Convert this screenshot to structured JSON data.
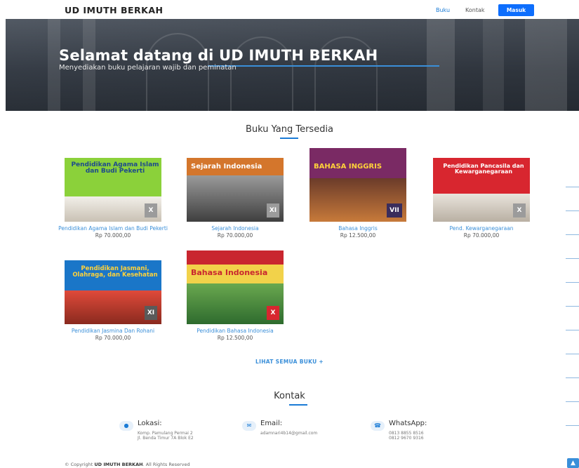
{
  "header": {
    "brand": "UD IMUTH BERKAH",
    "nav": {
      "buku": "Buku",
      "kontak": "Kontak"
    },
    "login_button": "Masuk"
  },
  "hero": {
    "title": "Selamat datang di UD IMUTH BERKAH",
    "subtitle": "Menyediakan buku pelajaran wajib dan peminatan"
  },
  "books_section": {
    "title": "Buku Yang Tersedia",
    "books": [
      {
        "name": "Pendidikan Agama Islam dan Budi Pekerti",
        "price": "Rp 70.000,00",
        "cover_title": "Pendidikan Agama Islam dan Budi Pekerti",
        "cover_color": "#8bd13a",
        "badge": "X"
      },
      {
        "name": "Sejarah Indonesia",
        "price": "Rp 70.000,00",
        "cover_title": "Sejarah Indonesia",
        "cover_color": "#d4762c",
        "badge": "XI"
      },
      {
        "name": "Bahasa Inggris",
        "price": "Rp 12.500,00",
        "cover_title": "BAHASA INGGRIS",
        "cover_color": "#7a2a64",
        "badge": "VII"
      },
      {
        "name": "Pend. Kewarganegaraan",
        "price": "Rp 70.000,00",
        "cover_title": "Pendidikan Pancasila dan Kewarganegaraan",
        "cover_color": "#d8262f",
        "badge": "X"
      },
      {
        "name": "Pendidikan Jasmina Dan Rohani",
        "price": "Rp 70.000,00",
        "cover_title": "Pendidikan Jasmani, Olahraga, dan Kesehatan",
        "cover_color": "#1a76c8",
        "badge": "XI"
      },
      {
        "name": "Pendidikan Bahasa Indonesia",
        "price": "Rp 12.500,00",
        "cover_title": "Bahasa Indonesia",
        "cover_color": "#f2d24a",
        "badge": "X"
      }
    ],
    "see_all": "LIHAT SEMUA BUKU +"
  },
  "contact_section": {
    "title": "Kontak",
    "location": {
      "label": "Lokasi:",
      "line1": "Komp. Pamulang Permai 2",
      "line2": "Jl. Benda Timur 7A Blok E2"
    },
    "email": {
      "label": "Email:",
      "line1": "adamnari4b14@gmail.com"
    },
    "whatsapp": {
      "label": "WhatsApp:",
      "line1": "0813 8855 8516",
      "line2": "0812 9670 9316"
    }
  },
  "footer": {
    "prefix": "© Copyright",
    "brand": "UD IMUTH BERKAH",
    "suffix": ". All Rights Reserved"
  },
  "icons": {
    "location": "map-pin-icon",
    "email": "envelope-icon",
    "whatsapp": "phone-icon",
    "scroll_top": "chevron-up-icon"
  },
  "colors": {
    "accent": "#1a7bd6",
    "login_button": "#0d6efd"
  }
}
